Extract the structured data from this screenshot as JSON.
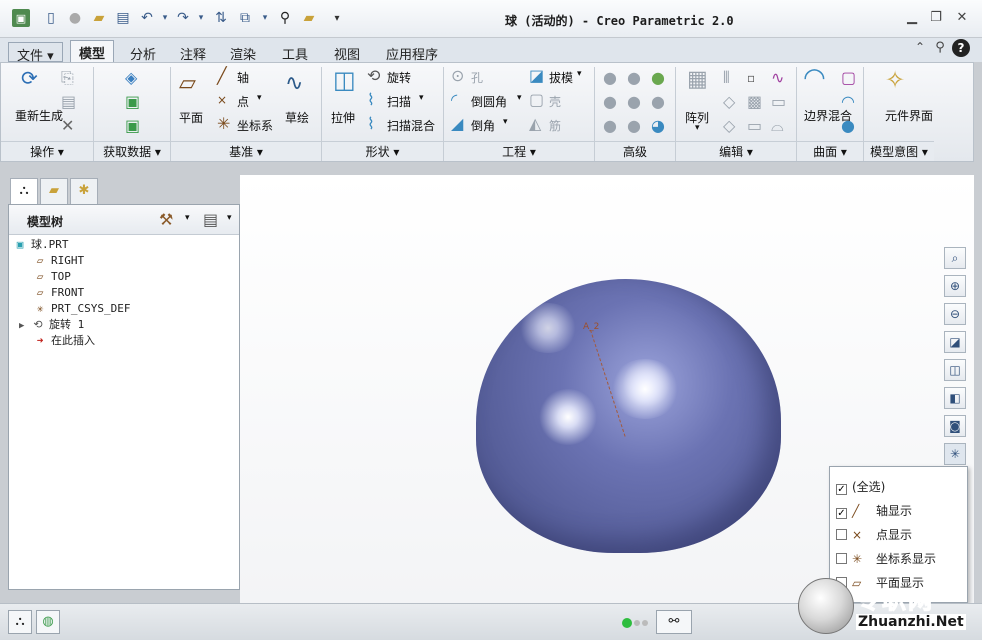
{
  "window": {
    "title": "球 (活动的) - Creo Parametric 2.0"
  },
  "quick_access": [
    "app-icon",
    "new-icon",
    "record-icon",
    "open-icon",
    "save-icon",
    "undo-icon",
    "redo-icon",
    "regen-icon",
    "windows-icon",
    "find-icon",
    "folder-icon",
    "customize-icon"
  ],
  "tabs": [
    "文件 ▾",
    "模型",
    "分析",
    "注释",
    "渲染",
    "工具",
    "视图",
    "应用程序"
  ],
  "active_tab": "模型",
  "ribbon": {
    "operations": {
      "regenerate": "重新生成",
      "group": "操作 ▾"
    },
    "get_data": {
      "group": "获取数据 ▾"
    },
    "datum": {
      "plane": "平面",
      "axis": "轴",
      "point": "点",
      "csys": "坐标系",
      "sketch": "草绘",
      "group": "基准 ▾"
    },
    "shapes": {
      "extrude": "拉伸",
      "revolve": "旋转",
      "sweep": "扫描",
      "swept_blend": "扫描混合",
      "group": "形状 ▾"
    },
    "engineering": {
      "hole": "孔",
      "round": "倒圆角",
      "chamfer": "倒角",
      "draft": "拔模",
      "shell": "壳",
      "rib": "筋",
      "group": "工程 ▾"
    },
    "advanced": {
      "group": "高级"
    },
    "editing": {
      "pattern": "阵列",
      "group": "编辑 ▾"
    },
    "surfaces": {
      "boundary_blend": "边界混合",
      "group": "曲面 ▾"
    },
    "model_intent": {
      "component_interface": "元件界面",
      "group": "模型意图 ▾"
    }
  },
  "model_tree": {
    "title": "模型树",
    "items": [
      {
        "label": "球.PRT",
        "icon": "part-icon"
      },
      {
        "label": "RIGHT",
        "icon": "datum-plane-icon"
      },
      {
        "label": "TOP",
        "icon": "datum-plane-icon"
      },
      {
        "label": "FRONT",
        "icon": "datum-plane-icon"
      },
      {
        "label": "PRT_CSYS_DEF",
        "icon": "csys-icon"
      },
      {
        "label": "旋转 1",
        "icon": "revolve-icon"
      },
      {
        "label": "在此插入",
        "icon": "insert-here-arrow-icon"
      }
    ]
  },
  "graphics": {
    "axis_label": "A_2",
    "model_color": "#5a62a0"
  },
  "datum_display_menu": {
    "items": [
      {
        "label": "(全选)",
        "checked": true
      },
      {
        "label": "轴显示",
        "checked": true
      },
      {
        "label": "点显示",
        "checked": false
      },
      {
        "label": "坐标系显示",
        "checked": false
      },
      {
        "label": "平面显示",
        "checked": false
      }
    ]
  },
  "watermark": {
    "text_cn": "专职网",
    "text_en": "Zhuanzhi.Net"
  }
}
